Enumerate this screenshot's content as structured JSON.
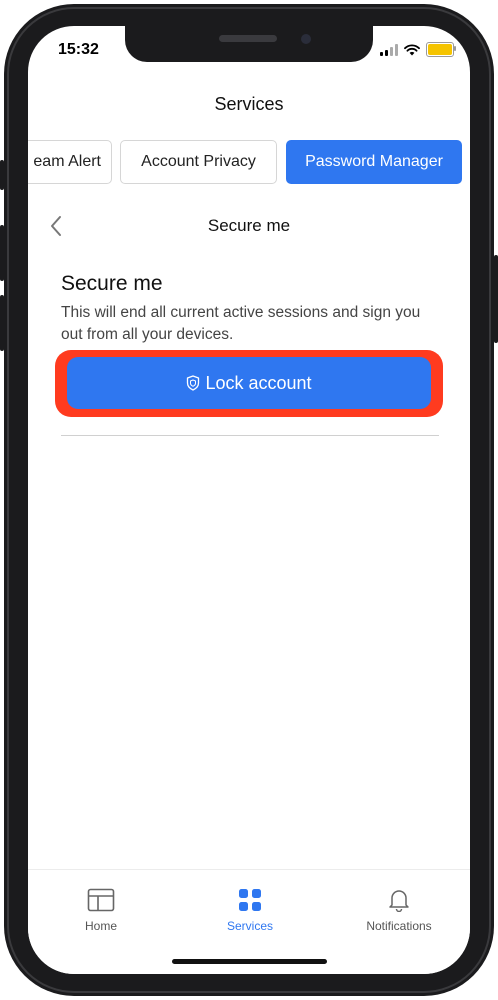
{
  "status_bar": {
    "time": "15:32"
  },
  "header": {
    "title": "Services"
  },
  "tabs": [
    {
      "label": "eam Alert",
      "active": false
    },
    {
      "label": "Account Privacy",
      "active": false
    },
    {
      "label": "Password Manager",
      "active": true
    }
  ],
  "subheader": {
    "title": "Secure me",
    "back_icon": "chevron-left-icon"
  },
  "section": {
    "title": "Secure me",
    "description": "This will end all current active sessions and sign you out from all your devices.",
    "lock_button": {
      "label": "Lock account",
      "icon": "shield-icon"
    }
  },
  "bottom_nav": [
    {
      "label": "Home",
      "icon": "layout-icon",
      "active": false
    },
    {
      "label": "Services",
      "icon": "grid-icon",
      "active": true
    },
    {
      "label": "Notifications",
      "icon": "bell-icon",
      "active": false
    }
  ],
  "colors": {
    "accent": "#2f77f0",
    "highlight": "#ff3b1f",
    "battery": "#f5c400"
  }
}
